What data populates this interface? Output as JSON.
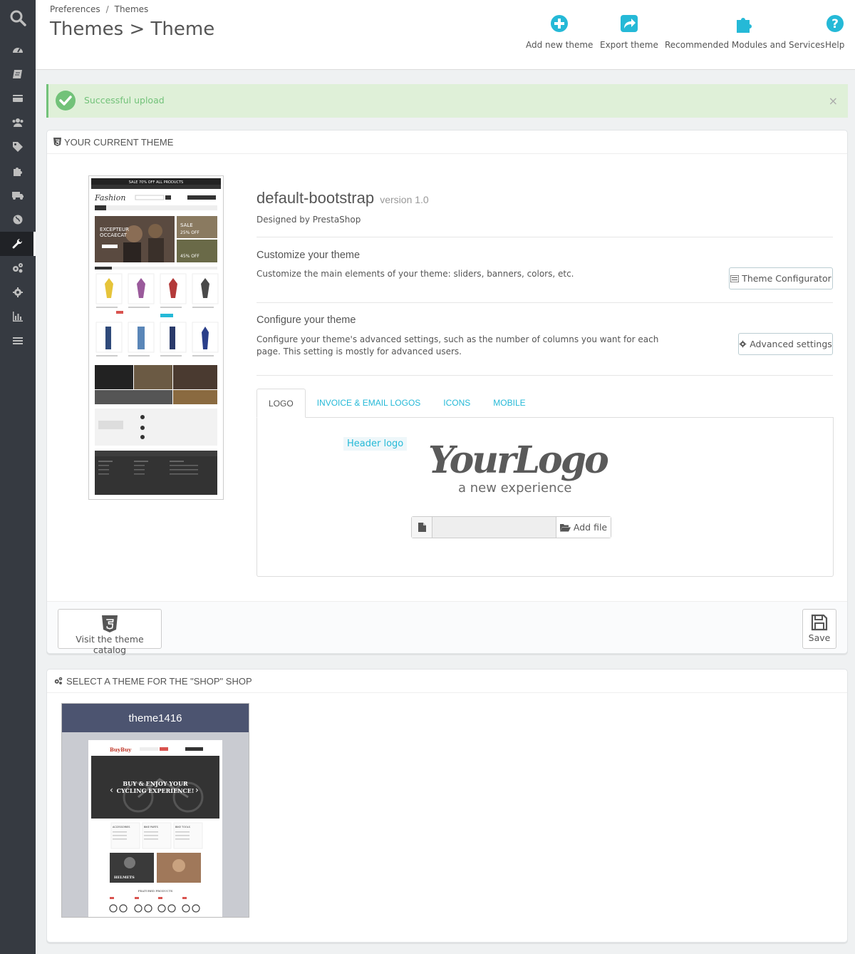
{
  "sidebar": {
    "items": [
      {
        "icon": "dashboard-icon"
      },
      {
        "icon": "orders-icon"
      },
      {
        "icon": "catalog-icon"
      },
      {
        "icon": "customers-icon"
      },
      {
        "icon": "price-rules-icon"
      },
      {
        "icon": "modules-icon"
      },
      {
        "icon": "shipping-icon"
      },
      {
        "icon": "localization-icon"
      },
      {
        "icon": "preferences-icon",
        "active": true
      },
      {
        "icon": "advanced-parameters-icon"
      },
      {
        "icon": "administration-icon"
      },
      {
        "icon": "stats-icon"
      },
      {
        "icon": "menu-collapse-icon"
      }
    ]
  },
  "header": {
    "breadcrumb": [
      "Preferences",
      "Themes"
    ],
    "title": "Themes > Theme",
    "toolbar": {
      "add": "Add new theme",
      "export": "Export theme",
      "modules": "Recommended Modules and Services",
      "help": "Help"
    }
  },
  "alert": {
    "message": "Successful upload",
    "close": "×"
  },
  "current_theme": {
    "heading": "Your current theme",
    "name": "default-bootstrap",
    "version": "version 1.0",
    "designer": "Designed by PrestaShop",
    "customize": {
      "title": "Customize your theme",
      "desc": "Customize the main elements of your theme: sliders, banners, colors, etc.",
      "button": "Theme Configurator"
    },
    "configure": {
      "title": "Configure your theme",
      "desc_line1": "Configure your theme's advanced settings, such as the number of columns you want for each",
      "desc_line2": "page. This setting is mostly for advanced users.",
      "button": "Advanced settings"
    },
    "tabs": [
      "Logo",
      "Invoice & Email Logos",
      "Icons",
      "Mobile"
    ],
    "logo": {
      "label": "Header logo",
      "logo_text": "YourLogo",
      "logo_tagline": "a new experience",
      "add_file": "Add file"
    },
    "footer": {
      "catalog": "Visit the theme catalog",
      "save": "Save"
    },
    "thumb": {
      "banner": "SALE 70% OFF ALL PRODUCTS",
      "brand": "Fashion",
      "hero1": "EXCEPTEUR",
      "hero2": "OCCAECAT",
      "sale": "SALE",
      "pct1": "25% OFF",
      "pct2": "45% OFF"
    }
  },
  "select_theme": {
    "heading": "Select a theme for the \"Shop\" shop",
    "themes": [
      {
        "name": "theme1416",
        "brand": "BuyBuy",
        "hero1": "BUY & ENJOY YOUR",
        "hero2": "CYCLING EXPERIENCE!",
        "cats": [
          "ACCESSORIES",
          "BIKE PARTS",
          "BIKE TOOLS"
        ],
        "helmets": "HELMETS",
        "featured": "FEATURED PRODUCTS"
      }
    ]
  }
}
